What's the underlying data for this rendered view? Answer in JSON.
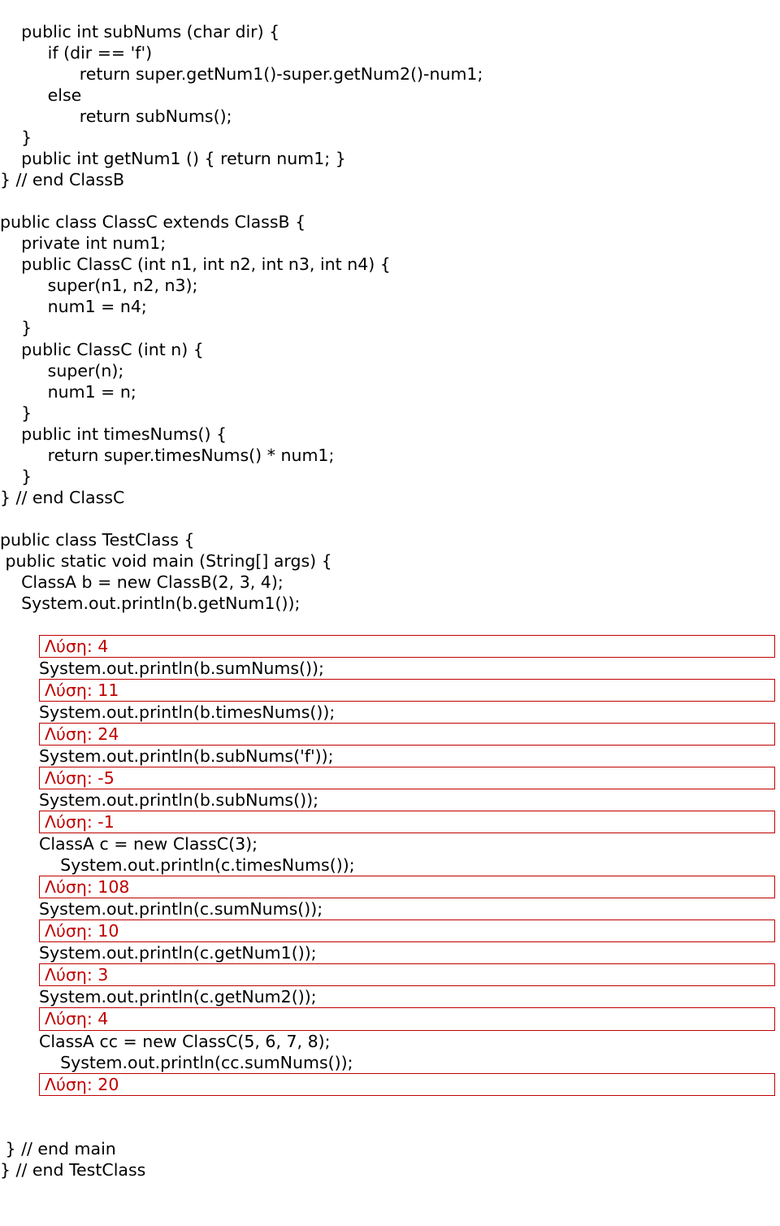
{
  "code_block1": [
    "    public int subNums (char dir) {",
    "         if (dir == 'f')",
    "               return super.getNum1()-super.getNum2()-num1;",
    "         else",
    "               return subNums();",
    "    }",
    "    public int getNum1 () { return num1; }",
    "} // end ClassB",
    "",
    "public class ClassC extends ClassB {",
    "    private int num1;",
    "    public ClassC (int n1, int n2, int n3, int n4) {",
    "         super(n1, n2, n3);",
    "         num1 = n4;",
    "    }",
    "    public ClassC (int n) {",
    "         super(n);",
    "         num1 = n;",
    "    }",
    "    public int timesNums() {",
    "         return super.timesNums() * num1;",
    "    }",
    "} // end ClassC",
    "",
    "public class TestClass {",
    " public static void main (String[] args) {",
    "    ClassA b = new ClassB(2, 3, 4);",
    "    System.out.println(b.getNum1());"
  ],
  "answers": [
    {
      "label": "Λύση: 4",
      "after": "System.out.println(b.sumNums());"
    },
    {
      "label": "Λύση: 11",
      "after": "System.out.println(b.timesNums());"
    },
    {
      "label": "Λύση: 24",
      "after": "System.out.println(b.subNums('f'));"
    },
    {
      "label": "Λύση: -5",
      "after": "System.out.println(b.subNums());"
    },
    {
      "label": "Λύση: -1",
      "after": "ClassA c = new ClassC(3);\n    System.out.println(c.timesNums());"
    },
    {
      "label": "Λύση: 108",
      "after": "System.out.println(c.sumNums());"
    },
    {
      "label": "Λύση: 10",
      "after": "System.out.println(c.getNum1());"
    },
    {
      "label": "Λύση: 3",
      "after": "System.out.println(c.getNum2());"
    },
    {
      "label": "Λύση: 4",
      "after": "ClassA cc = new ClassC(5, 6, 7, 8);\n    System.out.println(cc.sumNums());"
    },
    {
      "label": "Λύση: 20",
      "after": ""
    }
  ],
  "code_block2": [
    "",
    " } // end main",
    "} // end TestClass"
  ]
}
